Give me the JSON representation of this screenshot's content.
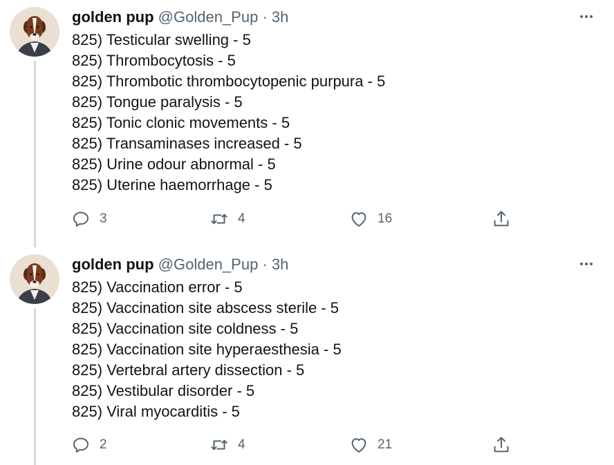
{
  "tweets": [
    {
      "name": "golden pup",
      "handle": "@Golden_Pup",
      "separator": "·",
      "time": "3h",
      "lines": [
        "825) Testicular swelling - 5",
        "825) Thrombocytosis - 5",
        "825) Thrombotic thrombocytopenic purpura - 5",
        "825) Tongue paralysis - 5",
        "825) Tonic clonic movements - 5",
        "825) Transaminases increased - 5",
        "825) Urine odour abnormal - 5",
        "825) Uterine haemorrhage - 5"
      ],
      "replies": "3",
      "retweets": "4",
      "likes": "16"
    },
    {
      "name": "golden pup",
      "handle": "@Golden_Pup",
      "separator": "·",
      "time": "3h",
      "lines": [
        "825) Vaccination error - 5",
        "825) Vaccination site abscess sterile - 5",
        "825) Vaccination site coldness - 5",
        "825) Vaccination site hyperaesthesia - 5",
        "825) Vertebral artery dissection - 5",
        "825) Vestibular disorder - 5",
        "825) Viral myocarditis - 5"
      ],
      "replies": "2",
      "retweets": "4",
      "likes": "21"
    }
  ],
  "icons": {
    "reply": "reply-icon",
    "retweet": "retweet-icon",
    "like": "heart-icon",
    "share": "share-icon",
    "more": "more-icon"
  },
  "colors": {
    "text": "#0f1419",
    "secondary": "#536471",
    "thread_line": "#cfd9de"
  }
}
